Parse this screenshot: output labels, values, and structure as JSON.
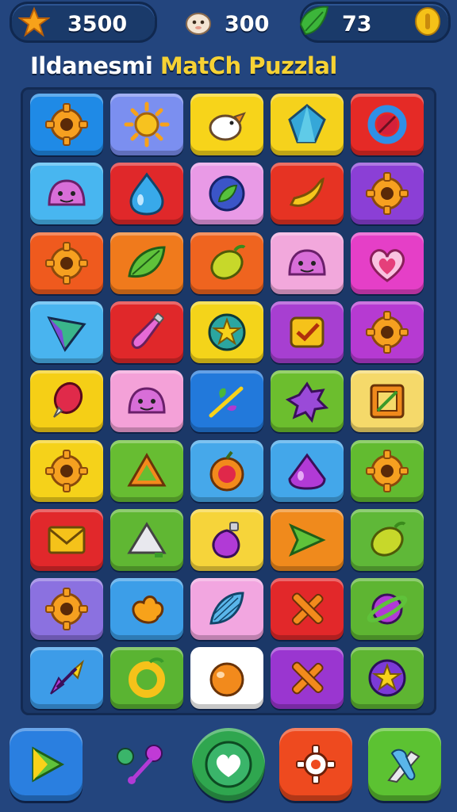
{
  "hud": {
    "stars": {
      "value": "3500",
      "icon": "star-icon"
    },
    "lives": {
      "value": "300",
      "icon": "creature-icon"
    },
    "gems": {
      "value": "73",
      "icon": "leaf-gem-icon"
    },
    "coin_icon": "coin-icon"
  },
  "title": {
    "part1": "Ildanesmi",
    "part2": "MatCh Puzzlal"
  },
  "board": {
    "rows": 9,
    "cols": 5,
    "tiles": [
      {
        "bg": "#1f8ae6",
        "icon": "gear"
      },
      {
        "bg": "#7b8ff0",
        "icon": "sun"
      },
      {
        "bg": "#f7d41a",
        "icon": "bird"
      },
      {
        "bg": "#f5d21c",
        "icon": "crystal"
      },
      {
        "bg": "#e52a26",
        "icon": "ring"
      },
      {
        "bg": "#48b6f0",
        "icon": "slime"
      },
      {
        "bg": "#e0282a",
        "icon": "drop"
      },
      {
        "bg": "#e99ae6",
        "icon": "orb-leaf"
      },
      {
        "bg": "#e63323",
        "icon": "banana"
      },
      {
        "bg": "#8b3fd6",
        "icon": "gear"
      },
      {
        "bg": "#ef5a1e",
        "icon": "gear"
      },
      {
        "bg": "#f07a1c",
        "icon": "leaf"
      },
      {
        "bg": "#ef641f",
        "icon": "lemon"
      },
      {
        "bg": "#f2a8dc",
        "icon": "slime"
      },
      {
        "bg": "#e53fc7",
        "icon": "heart"
      },
      {
        "bg": "#49b4ef",
        "icon": "kite"
      },
      {
        "bg": "#e0282a",
        "icon": "bottle"
      },
      {
        "bg": "#f4d41a",
        "icon": "star-badge"
      },
      {
        "bg": "#a73fd1",
        "icon": "check-box"
      },
      {
        "bg": "#b63ad2",
        "icon": "gear"
      },
      {
        "bg": "#f5cf16",
        "icon": "balloon"
      },
      {
        "bg": "#f4a1d8",
        "icon": "slime"
      },
      {
        "bg": "#2279db",
        "icon": "wand"
      },
      {
        "bg": "#6cbe2e",
        "icon": "splat"
      },
      {
        "bg": "#f5d96a",
        "icon": "frame"
      },
      {
        "bg": "#f5d21a",
        "icon": "gear"
      },
      {
        "bg": "#67bd32",
        "icon": "triangle"
      },
      {
        "bg": "#46a8ea",
        "icon": "apple"
      },
      {
        "bg": "#43a7ea",
        "icon": "gem"
      },
      {
        "bg": "#62bb30",
        "icon": "gear"
      },
      {
        "bg": "#e1282b",
        "icon": "envelope"
      },
      {
        "bg": "#60b733",
        "icon": "mountain"
      },
      {
        "bg": "#f6d43a",
        "icon": "potion"
      },
      {
        "bg": "#f08a1c",
        "icon": "arrow-right"
      },
      {
        "bg": "#5fb838",
        "icon": "lemon"
      },
      {
        "bg": "#8b71e0",
        "icon": "gear"
      },
      {
        "bg": "#3c9ee8",
        "icon": "blob"
      },
      {
        "bg": "#f2a6e0",
        "icon": "shell"
      },
      {
        "bg": "#e2282a",
        "icon": "cross"
      },
      {
        "bg": "#5eb532",
        "icon": "planet"
      },
      {
        "bg": "#3d9ce8",
        "icon": "arrows"
      },
      {
        "bg": "#5ab432",
        "icon": "ring-c"
      },
      {
        "bg": "#ffffff",
        "icon": "ball"
      },
      {
        "bg": "#9a36d0",
        "icon": "cross"
      },
      {
        "bg": "#5eb532",
        "icon": "star-orb"
      }
    ]
  },
  "actions": [
    {
      "name": "play-button",
      "bg": "#2a7fe0",
      "icon": "play-icon"
    },
    {
      "name": "key-button",
      "bg": "transparent",
      "icon": "key-icon"
    },
    {
      "name": "heart-button",
      "bg": "#2fa64f",
      "icon": "heart-icon"
    },
    {
      "name": "settings-button",
      "bg": "#ee4a1f",
      "icon": "gear-icon"
    },
    {
      "name": "tools-button",
      "bg": "#5cc232",
      "icon": "tools-icon"
    }
  ]
}
